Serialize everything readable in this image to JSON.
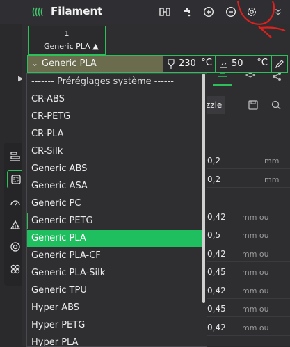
{
  "header": {
    "title": "Filament",
    "icons": [
      "spools-icon",
      "compare-icon",
      "faucet-icon",
      "add-icon",
      "remove-icon",
      "settings-icon",
      "expand-icon"
    ]
  },
  "extruder": {
    "index": "1",
    "preset": "Generic PLA ▲"
  },
  "filament_combo": {
    "value": "Generic PLA"
  },
  "temps": {
    "nozzle": {
      "value": "230",
      "unit": "°C"
    },
    "bed": {
      "value": "50",
      "unit": "°C"
    }
  },
  "background_panel": {
    "tab_fragment": "zzle",
    "values": [
      {
        "v": "0,2",
        "u": "mm"
      },
      {
        "v": "0,2",
        "u": "mm"
      },
      {
        "v": "0,42",
        "u": "mm ou"
      },
      {
        "v": "0,5",
        "u": "mm ou"
      },
      {
        "v": "0,42",
        "u": "mm ou"
      },
      {
        "v": "0,45",
        "u": "mm ou"
      },
      {
        "v": "0,42",
        "u": "mm ou"
      },
      {
        "v": "0,45",
        "u": "mm ou"
      },
      {
        "v": "0,42",
        "u": "mm ou"
      }
    ]
  },
  "dropdown": {
    "items": [
      "------- Préréglages système ------",
      "CR-ABS",
      "CR-PETG",
      "CR-PLA",
      "CR-Silk",
      "Generic ABS",
      "Generic ASA",
      "Generic PC",
      "Generic PETG",
      "Generic PLA",
      "Generic PLA-CF",
      "Generic PLA-Silk",
      "Generic TPU",
      "Hyper ABS",
      "Hyper PETG",
      "Hyper PLA"
    ],
    "hovered_index": 8,
    "selected_index": 9
  },
  "colors": {
    "accent": "#2dbf5a",
    "selected": "#1fbf5f",
    "annotation": "#e0201c"
  }
}
